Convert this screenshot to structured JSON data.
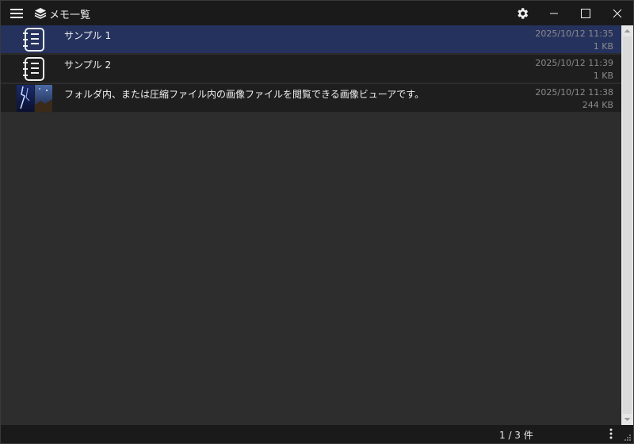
{
  "window": {
    "title": "メモ一覧",
    "icons": {
      "menu": "hamburger-menu-icon",
      "app": "stacked-layers-icon",
      "settings": "gear-icon",
      "minimize": "minimize-icon",
      "maximize": "maximize-icon",
      "close": "close-icon"
    }
  },
  "list": {
    "items": [
      {
        "name": "サンプル 1",
        "date": "2025/10/12 11:35",
        "size": "1 KB",
        "thumb": "notebook-icon",
        "selected": true
      },
      {
        "name": "サンプル 2",
        "date": "2025/10/12 11:39",
        "size": "1 KB",
        "thumb": "notebook-icon",
        "selected": false
      },
      {
        "name": "フォルダ内、または圧縮ファイル内の画像ファイルを閲覧できる画像ビューアです。",
        "date": "2025/10/12 11:38",
        "size": "244 KB",
        "thumb": "image-thumbnail",
        "selected": false
      }
    ]
  },
  "status": {
    "count": "1 / 3 件"
  },
  "colors": {
    "selected": "#26325e",
    "titlebar": "#1a1a1a",
    "background": "#2d2d2d"
  }
}
